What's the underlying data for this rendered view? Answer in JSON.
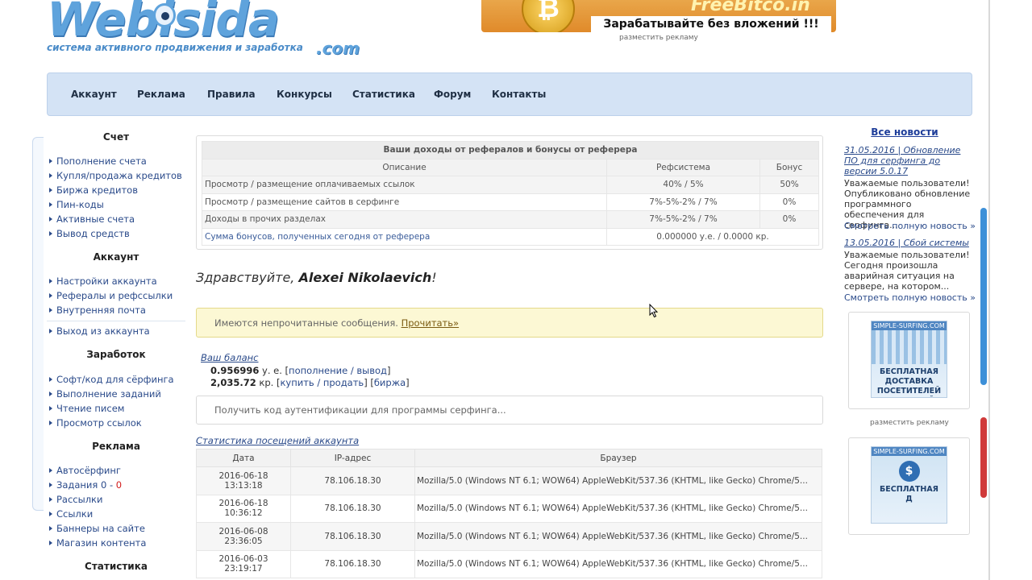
{
  "header": {
    "logo_word": "Webisida",
    "logo_com": ".com",
    "tagline": "система активного продвижения и заработка",
    "banner_brand": "FreeBitco.in",
    "banner_coin": "₿",
    "banner_slogan": "Зарабатывайте без вложений !!!",
    "banner_ad_link": "разместить рекламу"
  },
  "nav": [
    "Аккаунт",
    "Реклама",
    "Правила",
    "Конкурсы",
    "Статистика",
    "Форум",
    "Контакты"
  ],
  "sidebar": {
    "sections": [
      {
        "heading": "Счет",
        "items": [
          "Пополнение счета",
          "Купля/продажа кредитов",
          "Биржа кредитов",
          "Пин-коды",
          "Активные счета",
          "Вывод средств"
        ]
      },
      {
        "heading": "Аккаунт",
        "items": [
          "Настройки аккаунта",
          "Рефералы и рефссылки",
          "Внутренняя почта"
        ],
        "extra": "Выход из аккаунта"
      },
      {
        "heading": "Заработок",
        "items": [
          "Софт/код для сёрфинга",
          "Выполнение заданий",
          "Чтение писем",
          "Просмотр ссылок"
        ]
      },
      {
        "heading": "Реклама",
        "items": [
          "Автосёрфинг",
          "Задания 0 - ",
          "Рассылки",
          "Ссылки",
          "Баннеры на сайте",
          "Магазин контента"
        ],
        "tasks_red": "0"
      },
      {
        "heading": "Статистика"
      }
    ]
  },
  "earnings": {
    "title": "Ваши доходы от рефералов и бонусы от реферера",
    "columns": [
      "Описание",
      "Рефсистема",
      "Бонус"
    ],
    "rows": [
      [
        "Просмотр / размещение оплачиваемых ссылок",
        "40% / 5%",
        "50%"
      ],
      [
        "Просмотр / размещение сайтов в серфинге",
        "7%-5%-2% / 7%",
        "0%"
      ],
      [
        "Доходы в прочих разделах",
        "7%-5%-2% / 7%",
        "0%"
      ]
    ],
    "sum_label": "Сумма бонусов, полученных сегодня от реферера",
    "sum_value": "0.000000 у.е. / 0.0000 кр."
  },
  "greeting": {
    "prefix": "Здравствуйте, ",
    "name": "Alexei Nikolaevich",
    "suffix": "!"
  },
  "notice": {
    "text": "Имеются непрочитанные сообщения. ",
    "link": "Прочитать»"
  },
  "balance": {
    "title": "Ваш баланс",
    "usd_value": "0.956996",
    "usd_unit": " у. е. [",
    "usd_link": "пополнение / вывод",
    "usd_close": "]",
    "cr_value": "2,035.72",
    "cr_unit": " кр. [",
    "cr_link1": "купить / продать",
    "cr_mid": "] [",
    "cr_link2": "биржа",
    "cr_close": "]"
  },
  "auth": {
    "label": "Получить код аутентификации для программы серфинга..."
  },
  "visits": {
    "title": "Статистика посещений аккаунта",
    "columns": [
      "Дата",
      "IP-адрес",
      "Браузер"
    ],
    "rows": [
      {
        "date": "2016-06-18",
        "time": "13:13:18",
        "ip": "78.106.18.30",
        "ua": "Mozilla/5.0 (Windows NT 6.1; WOW64) AppleWebKit/537.36 (KHTML, like Gecko) Chrome/5..."
      },
      {
        "date": "2016-06-18",
        "time": "10:36:12",
        "ip": "78.106.18.30",
        "ua": "Mozilla/5.0 (Windows NT 6.1; WOW64) AppleWebKit/537.36 (KHTML, like Gecko) Chrome/5..."
      },
      {
        "date": "2016-06-08",
        "time": "23:36:05",
        "ip": "78.106.18.30",
        "ua": "Mozilla/5.0 (Windows NT 6.1; WOW64) AppleWebKit/537.36 (KHTML, like Gecko) Chrome/5..."
      },
      {
        "date": "2016-06-03",
        "time": "23:19:17",
        "ip": "78.106.18.30",
        "ua": "Mozilla/5.0 (Windows NT 6.1; WOW64) AppleWebKit/537.36 (KHTML, like Gecko) Chrome/5..."
      }
    ]
  },
  "news": {
    "all_link": "Все новости",
    "items": [
      {
        "date_title": "31.05.2016 | Обновление ПО для серфинга до версии 5.0.17",
        "text": "Уважаемые пользователи! Опубликовано обновление программного обеспечения для серфинга...",
        "more": "Смотреть полную новость »"
      },
      {
        "date_title": "13.05.2016 | Сбой системы",
        "text": "Уважаемые пользователи! Сегодня произошла аварийная ситуация на сервере, на котором...",
        "more": "Смотреть полную новость »"
      }
    ]
  },
  "right_ads": {
    "brand": "SIMPLE-SURFING.COM",
    "ad1_text": "БЕСПЛАТНАЯ ДОСТАВКА ПОСЕТИТЕЛЕЙ НА ВАШ САЙТ",
    "ad2_text": "БЕСПЛАТНАЯ",
    "ad2_sub": "Д",
    "ad2_money": "$",
    "place_link": "разместить рекламу"
  }
}
